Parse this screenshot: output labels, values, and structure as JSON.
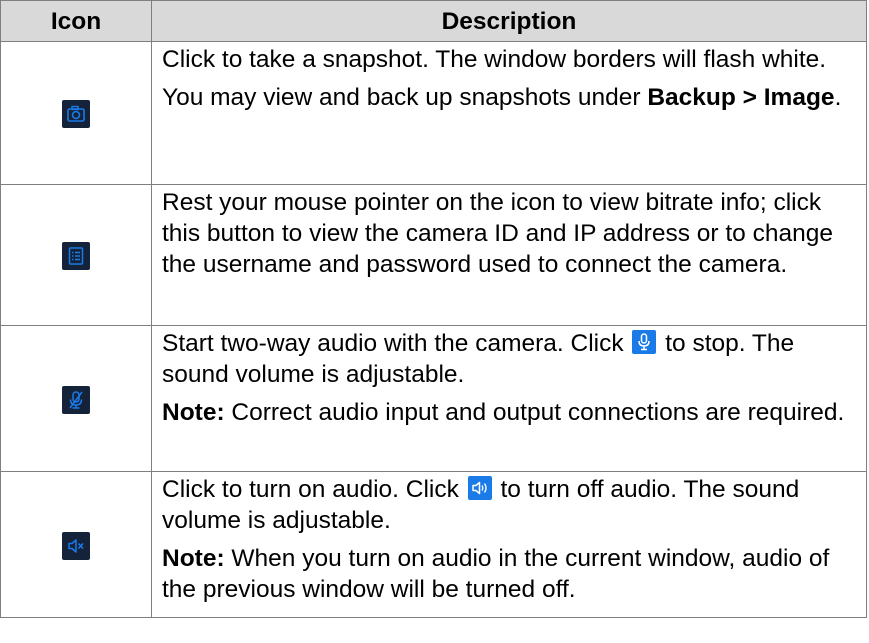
{
  "table": {
    "headers": {
      "icon": "Icon",
      "description": "Description"
    },
    "rows": [
      {
        "icon": "camera-snapshot-icon",
        "paragraphs": {
          "p1": "Click to take a snapshot. The window borders will flash white.",
          "p2_text": "You may view and back up snapshots under ",
          "p2_bold": "Backup > Image",
          "p2_end": "."
        }
      },
      {
        "icon": "list-info-icon",
        "paragraphs": {
          "p1": "Rest your mouse pointer on the icon to view bitrate info; click this button to view the camera ID and IP address or to change the username and password used to connect the camera."
        }
      },
      {
        "icon": "microphone-off-icon",
        "inline_icon": "microphone-icon",
        "paragraphs": {
          "p1_before": "Start two-way audio with the camera. Click ",
          "p1_after": " to stop. The sound volume is adjustable.",
          "note_label": "Note:",
          "note_text": " Correct audio input and output connections are required."
        }
      },
      {
        "icon": "speaker-muted-icon",
        "inline_icon": "speaker-on-icon",
        "paragraphs": {
          "p1_before": "Click to turn on audio. Click ",
          "p1_after": " to turn off audio. The sound volume is adjustable.",
          "note_label": "Note:",
          "note_text": " When you turn on audio in the current window, audio of the previous window will be turned off."
        }
      }
    ]
  },
  "colors": {
    "header_bg": "#d9d9d9",
    "border": "#7f7f7f",
    "icon_box_bg": "#15233a",
    "icon_accent": "#1a7be8"
  }
}
